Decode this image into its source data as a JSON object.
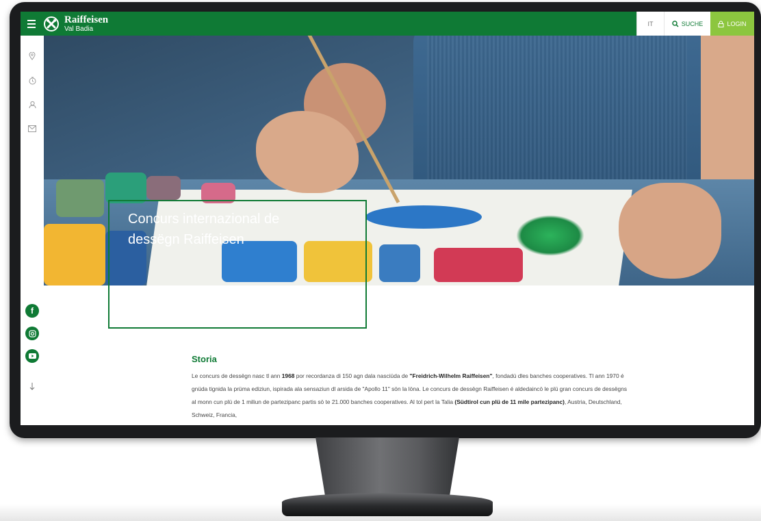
{
  "header": {
    "brand_name": "Raiffeisen",
    "brand_sub": "Val Badia",
    "lang_label": "IT",
    "search_label": "SUCHE",
    "login_label": "LOGIN"
  },
  "hero": {
    "title": "Concurs internazional de dessëgn Raiffeisen"
  },
  "content": {
    "section_title": "Storia",
    "p_part1": "Le concurs de dessëgn nasc tl ann ",
    "p_bold1": "1968",
    "p_part2": " por recordanza di 150 agn dala nasciüda de ",
    "p_bold2": "\"Freidrich-Wilhelm Raiffeisen\"",
    "p_part3": ", fondadú dles banches cooperatives. Tl ann 1970 é gnüda tignida la prüma ediziun, ispirada ala sensaziun dl arsida de \"Apollo 11\" sön la löna. Le concurs de dessëgn Raiffeisen é aldedaincö le plü gran concurs de dessëgns al monn cun plü de 1 miliun de partezipanc partis sö te 21.000 banches cooperatives. Al tol pert la Talia ",
    "p_bold3": "(Südtirol cun plü de 11 mile partezipanc)",
    "p_part4": ", Austria, Deutschland, Schweiz, Francia,"
  },
  "rail": {
    "icons": [
      "location-icon",
      "clock-icon",
      "user-icon",
      "mail-icon"
    ],
    "social": [
      "facebook-icon",
      "instagram-icon",
      "youtube-icon"
    ]
  },
  "colors": {
    "brand_green": "#0f7a35",
    "login_green": "#8cc63f"
  }
}
